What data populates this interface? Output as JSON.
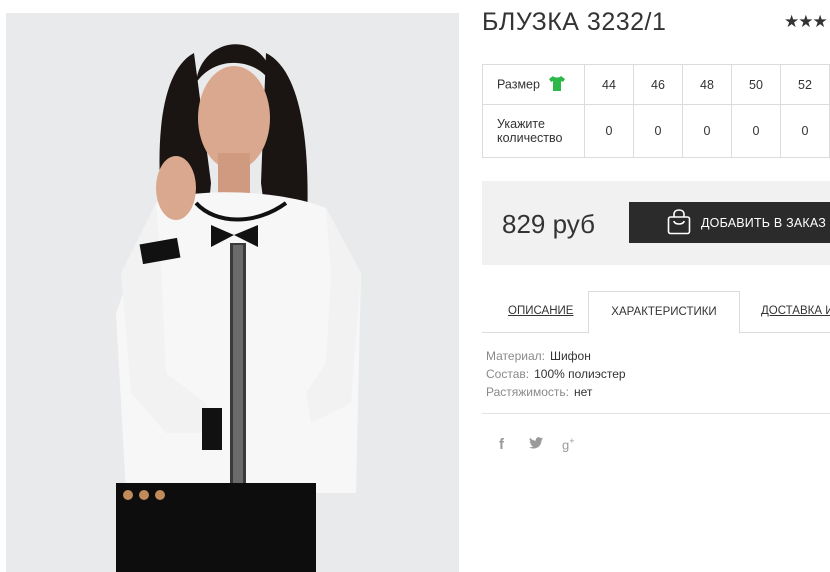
{
  "product": {
    "title": "БЛУЗКА 3232/1",
    "rating_stars": "★★★"
  },
  "sizes": {
    "size_label": "Размер",
    "size_icon": "tshirt-icon",
    "size_icon_color": "#2fb84a",
    "sizes": [
      "44",
      "46",
      "48",
      "50",
      "52"
    ],
    "qty_label": "Укажите количество",
    "quantities": [
      "0",
      "0",
      "0",
      "0",
      "0"
    ]
  },
  "purchase": {
    "price": "829 руб",
    "add_button_label": "ДОБАВИТЬ В ЗАКАЗ",
    "button_icon": "shopping-bag-icon",
    "button_color": "#2b2b2b"
  },
  "tabs": [
    {
      "label": "ОПИСАНИЕ",
      "active": false
    },
    {
      "label": "ХАРАКТЕРИСТИКИ",
      "active": true
    },
    {
      "label": "ДОСТАВКА И",
      "active": false
    }
  ],
  "specs": [
    {
      "key": "Материал:",
      "value": "Шифон"
    },
    {
      "key": "Состав:",
      "value": "100% полиэстер"
    },
    {
      "key": "Растяжимость:",
      "value": "нет"
    }
  ],
  "social": [
    {
      "icon": "facebook-icon",
      "glyph": "f"
    },
    {
      "icon": "twitter-icon",
      "glyph": "🐦"
    },
    {
      "icon": "google-plus-icon",
      "glyph": "g+"
    }
  ]
}
